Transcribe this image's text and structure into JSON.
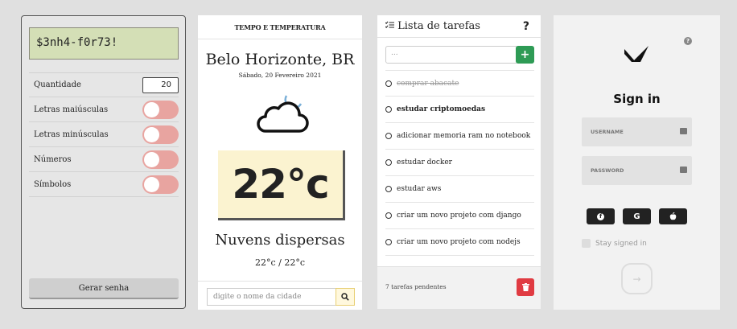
{
  "password_generator": {
    "generated_password": "$3nh4-f0r73!",
    "quantity_label": "Quantidade",
    "quantity_value": "20",
    "options": [
      {
        "label": "Letras maiúsculas",
        "enabled": false
      },
      {
        "label": "Letras minúsculas",
        "enabled": false
      },
      {
        "label": "Números",
        "enabled": false
      },
      {
        "label": "Símbolos",
        "enabled": false
      }
    ],
    "generate_label": "Gerar senha",
    "toggle_color": "#e8a4a0"
  },
  "weather": {
    "header": "TEMPO E TEMPERATURA",
    "city": "Belo Horizonte, BR",
    "date": "Sábado, 20 Fevereiro 2021",
    "icon": "cloud-moon-icon",
    "temperature": "22°c",
    "description": "Nuvens dispersas",
    "min_max": "22°c / 22°c",
    "search_placeholder": "digite o nome da cidade"
  },
  "todo": {
    "title": "Lista de tarefas",
    "help": "?",
    "input_value": "...",
    "add_label": "+",
    "items": [
      {
        "text": "comprar abacate",
        "done": true,
        "bold": false
      },
      {
        "text": "estudar criptomoedas",
        "done": false,
        "bold": true
      },
      {
        "text": "adicionar memoria ram no notebook",
        "done": false,
        "bold": false
      },
      {
        "text": "estudar docker",
        "done": false,
        "bold": false
      },
      {
        "text": "estudar aws",
        "done": false,
        "bold": false
      },
      {
        "text": "criar um novo projeto com django",
        "done": false,
        "bold": false
      },
      {
        "text": "criar um novo projeto com nodejs",
        "done": false,
        "bold": false
      }
    ],
    "pending": "7 tarefas pendentes",
    "add_color": "#2e9b55",
    "delete_color": "#e03b42"
  },
  "signin": {
    "title": "Sign in",
    "help": "?",
    "username_label": "USERNAME",
    "password_label": "PASSWORD",
    "social": [
      {
        "label": "f",
        "icon": "facebook-icon"
      },
      {
        "label": "G",
        "icon": "google-icon"
      },
      {
        "label": "",
        "icon": "apple-icon"
      }
    ],
    "stay_label": "Stay signed in",
    "submit": "→"
  }
}
